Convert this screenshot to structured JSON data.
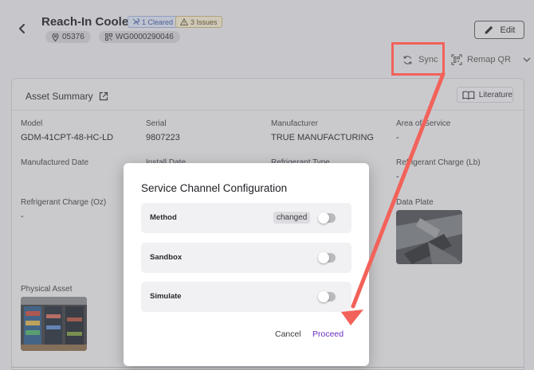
{
  "header": {
    "title": "Reach-In Cooler",
    "badge_cleared": "1 Cleared",
    "badge_issues": "3 Issues",
    "location": "05376",
    "asset_code": "WG0000290046",
    "edit_label": "Edit",
    "sync_label": "Sync",
    "remap_label": "Remap QR"
  },
  "card": {
    "title": "Asset Summary",
    "literature_label": "Literature",
    "fields": {
      "model_label": "Model",
      "model_value": "GDM-41CPT-48-HC-LD",
      "serial_label": "Serial",
      "serial_value": "9807223",
      "manufacturer_label": "Manufacturer",
      "manufacturer_value": "TRUE MANUFACTURING",
      "area_label": "Area of Service",
      "area_value": "-",
      "manufactured_label": "Manufactured Date",
      "install_label": "Install Date",
      "refrigerant_type_label": "Refrigerant Type",
      "charge_lb_label": "Refrigerant Charge (Lb)",
      "charge_lb_value": "-",
      "charge_oz_label": "Refrigerant Charge (Oz)",
      "charge_oz_value": "-",
      "data_plate_label": "Data Plate",
      "physical_label": "Physical Asset"
    }
  },
  "modal": {
    "title": "Service Channel Configuration",
    "options": [
      {
        "label": "Method",
        "chip": "changed",
        "enabled": false
      },
      {
        "label": "Sandbox",
        "enabled": false
      },
      {
        "label": "Simulate",
        "enabled": false
      }
    ],
    "cancel_label": "Cancel",
    "proceed_label": "Proceed"
  },
  "colors": {
    "accent": "#6a2fc4",
    "annotation": "#f2625a"
  }
}
